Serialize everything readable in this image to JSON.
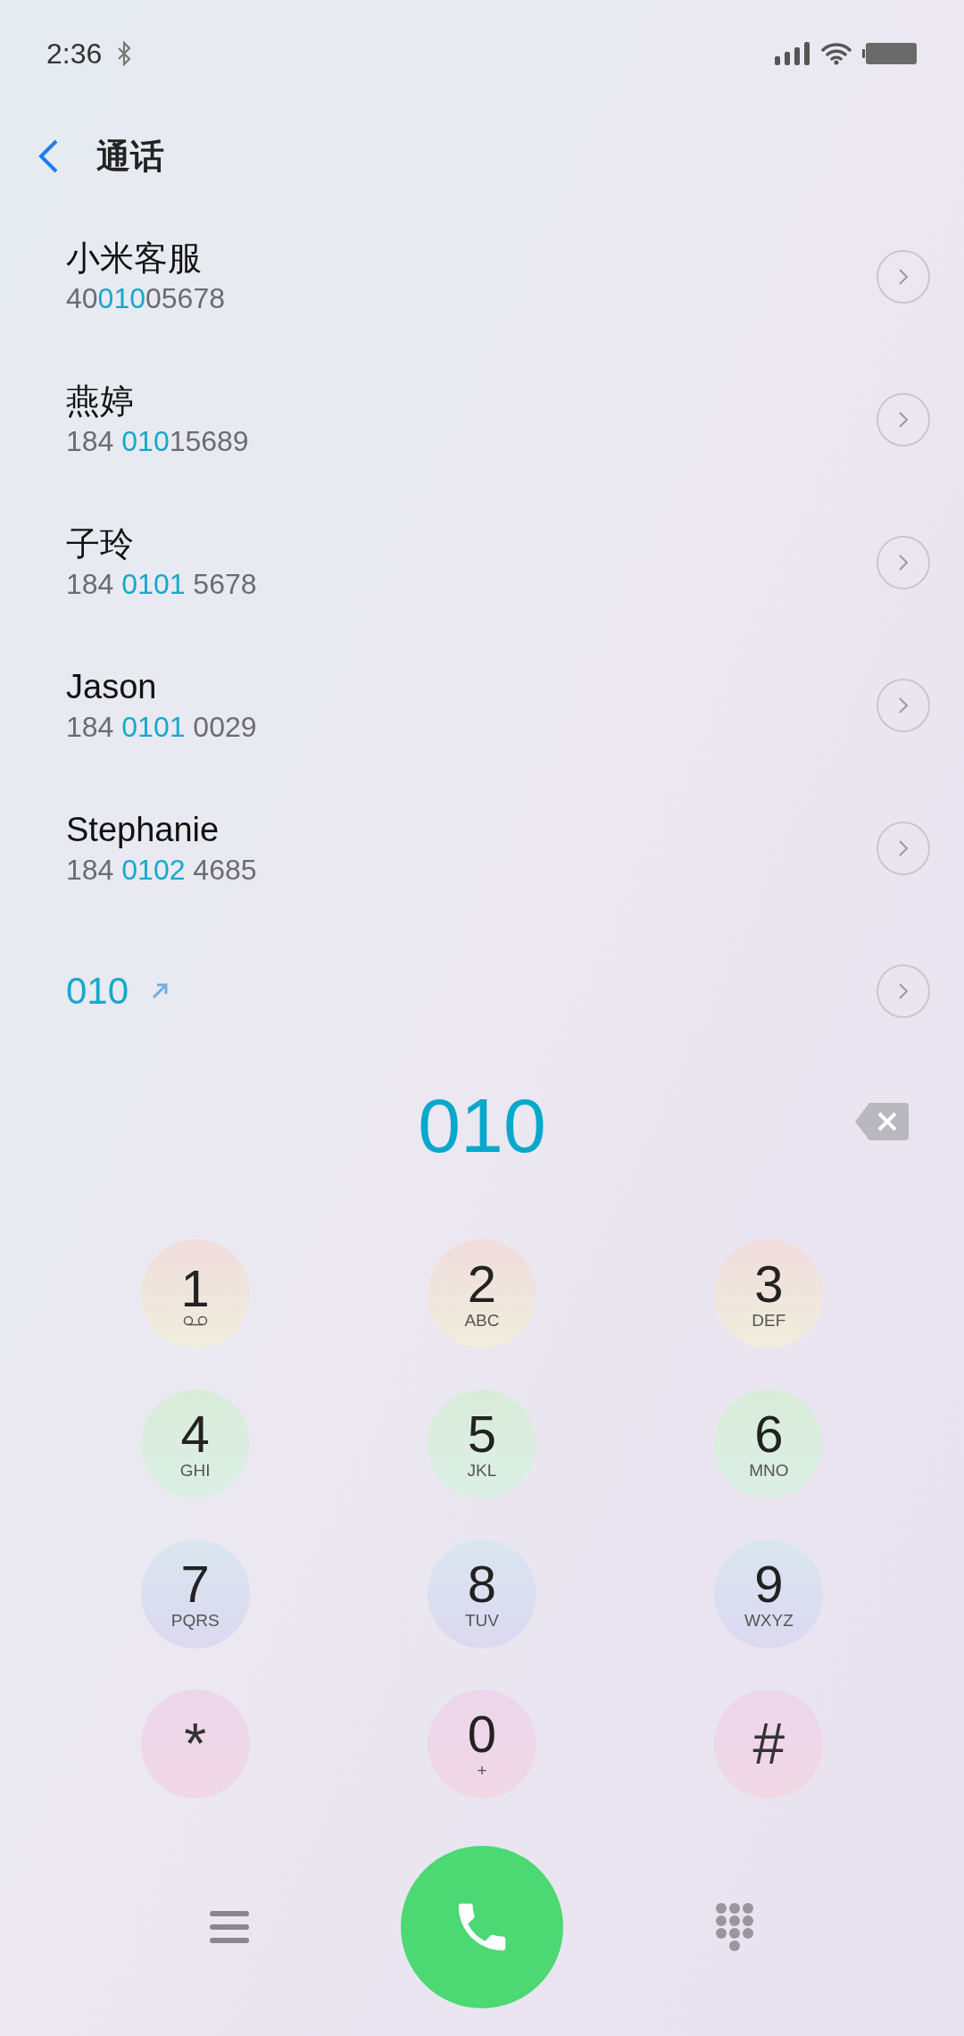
{
  "status_bar": {
    "time": "2:36"
  },
  "header": {
    "title": "通话"
  },
  "results": [
    {
      "kind": "contact",
      "name": "小米客服",
      "number": [
        {
          "text": "40",
          "match": false
        },
        {
          "text": "010",
          "match": true
        },
        {
          "text": "05678",
          "match": false
        }
      ]
    },
    {
      "kind": "contact",
      "name": "燕婷",
      "number": [
        {
          "text": "184 ",
          "match": false
        },
        {
          "text": "010",
          "match": true
        },
        {
          "text": "15689",
          "match": false
        }
      ]
    },
    {
      "kind": "contact",
      "name": "子玲",
      "number": [
        {
          "text": "184 ",
          "match": false
        },
        {
          "text": "0101",
          "match": true
        },
        {
          "text": " 5678",
          "match": false
        }
      ]
    },
    {
      "kind": "contact",
      "name": "Jason",
      "number": [
        {
          "text": "184 ",
          "match": false
        },
        {
          "text": "0101",
          "match": true
        },
        {
          "text": " 0029",
          "match": false
        }
      ]
    },
    {
      "kind": "contact",
      "name": "Stephanie",
      "number": [
        {
          "text": "184 ",
          "match": false
        },
        {
          "text": "0102",
          "match": true
        },
        {
          "text": " 4685",
          "match": false
        }
      ]
    },
    {
      "kind": "new-number",
      "name": "010"
    }
  ],
  "dialed": "010",
  "keys": [
    {
      "kind": "voicemail-digit",
      "main": "1"
    },
    {
      "kind": "digit",
      "main": "2",
      "sub": "ABC"
    },
    {
      "kind": "digit",
      "main": "3",
      "sub": "DEF"
    },
    {
      "kind": "digit",
      "main": "4",
      "sub": "GHI"
    },
    {
      "kind": "digit",
      "main": "5",
      "sub": "JKL"
    },
    {
      "kind": "digit",
      "main": "6",
      "sub": "MNO"
    },
    {
      "kind": "digit",
      "main": "7",
      "sub": "PQRS"
    },
    {
      "kind": "digit",
      "main": "8",
      "sub": "TUV"
    },
    {
      "kind": "digit",
      "main": "9",
      "sub": "WXYZ"
    },
    {
      "kind": "symbol",
      "main": "*"
    },
    {
      "kind": "digit",
      "main": "0",
      "sub": "+"
    },
    {
      "kind": "symbol",
      "main": "#"
    }
  ]
}
